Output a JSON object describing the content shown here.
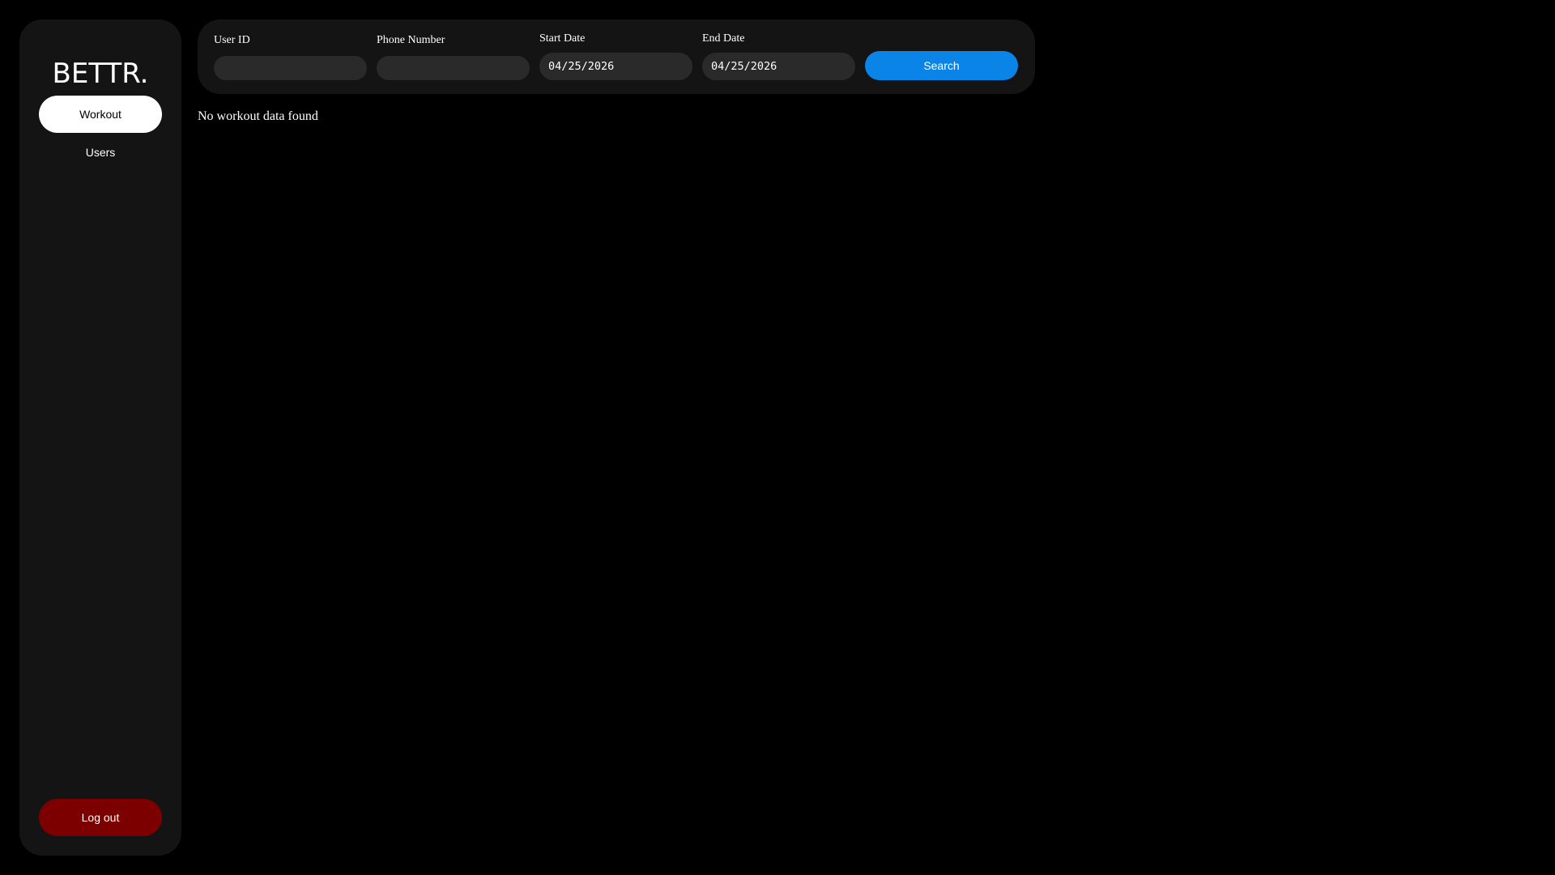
{
  "app": {
    "logo_text": "BETTR."
  },
  "sidebar": {
    "items": [
      {
        "label": "Workout",
        "active": true
      },
      {
        "label": "Users",
        "active": false
      }
    ],
    "logout_label": "Log out"
  },
  "filters": {
    "user_id": {
      "label": "User ID",
      "value": ""
    },
    "phone": {
      "label": "Phone Number",
      "value": ""
    },
    "start_date": {
      "label": "Start Date",
      "value": "04/25/2026"
    },
    "end_date": {
      "label": "End Date",
      "value": "04/25/2026"
    },
    "search_label": "Search"
  },
  "main": {
    "empty_message": "No workout data found"
  },
  "colors": {
    "background": "#000000",
    "panel": "#141414",
    "input": "#2a2a2a",
    "accent": "#0a84e6",
    "danger": "#7d0000",
    "active_nav": "#ffffff"
  }
}
